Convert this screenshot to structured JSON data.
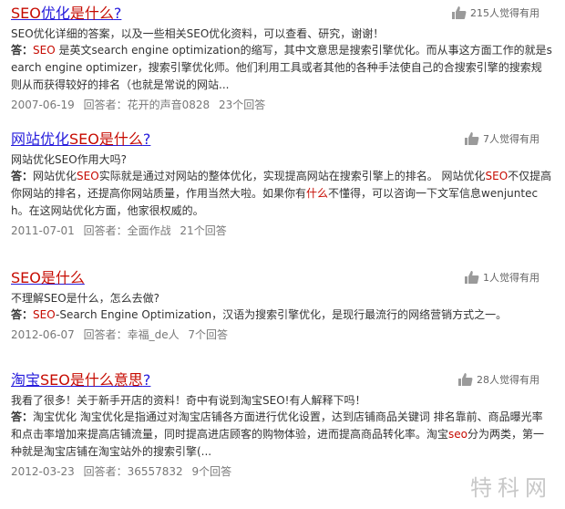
{
  "results": [
    {
      "title_pre": "",
      "title_hl": "SEO",
      "title_mid": "优化",
      "title_hl2": "是什么",
      "title_post": "?",
      "votes": "215人觉得有用",
      "question": "SEO优化详细的答案，以及一些相关SEO优化资料，可以查看、研究，谢谢！",
      "answer_label": "答：",
      "answer_parts": [
        {
          "t": "SEO",
          "hl": true
        },
        {
          "t": " 是英文search engine optimization的缩写，其中文意思是搜索引擎优化。而从事这方面工作的就是search engine optimizer，搜索引擎优化师。他们利用工具或者其他的各种手法使自己的合搜索引擎的搜索规则从而获得较好的排名（也就是常说的网站...",
          "hl": false
        }
      ],
      "date": "2007-06-19",
      "answerer": "回答者：花开的声音0828",
      "count": "23个回答"
    },
    {
      "title_pre": "网站优化",
      "title_hl": "SEO",
      "title_mid": "",
      "title_hl2": "是什么",
      "title_post": "?",
      "votes": "7人觉得有用",
      "question": "网站优化SEO作用大吗?",
      "answer_label": "答：",
      "answer_parts": [
        {
          "t": "网站优化",
          "hl": false
        },
        {
          "t": "SEO",
          "hl": true
        },
        {
          "t": "实际就是通过对网站的整体优化，实现提高网站在搜索引擎上的排名。 网站优化",
          "hl": false
        },
        {
          "t": "SEO",
          "hl": true
        },
        {
          "t": "不仅提高你网站的排名，还提高你网站质量，作用当然大啦。如果你有",
          "hl": false
        },
        {
          "t": "什么",
          "hl": true
        },
        {
          "t": "不懂得，可以咨询一下文军信息wenjuntech。在这网站优化方面，他家很权威的。",
          "hl": false
        }
      ],
      "date": "2011-07-01",
      "answerer": "回答者：全面作战",
      "count": "21个回答"
    },
    {
      "title_pre": "",
      "title_hl": "SEO是什么",
      "title_mid": "",
      "title_hl2": "",
      "title_post": "",
      "votes": "1人觉得有用",
      "question": "不理解SEO是什么，怎么去做?",
      "answer_label": "答：",
      "answer_parts": [
        {
          "t": "SEO",
          "hl": true
        },
        {
          "t": "-Search Engine Optimization，汉语为搜索引擎优化，是现行最流行的网络营销方式之一。",
          "hl": false
        }
      ],
      "date": "2012-06-07",
      "answerer": "回答者：幸福_de人",
      "count": "7个回答"
    },
    {
      "title_pre": "淘宝",
      "title_hl": "SEO是什么",
      "title_mid": "",
      "title_hl2": "意思",
      "title_post": "?",
      "votes": "28人觉得有用",
      "question": "我看了很多！关于新手开店的资料！奇中有说到淘宝SEO!有人解释下吗！",
      "answer_label": "答：",
      "answer_parts": [
        {
          "t": "淘宝优化 淘宝优化是指通过对淘宝店铺各方面进行优化设置，达到店铺商品关键词 排名靠前、商品曝光率和点击率增加来提高店铺流量，同时提高进店顾客的购物体验，进而提高商品转化率。淘宝",
          "hl": false
        },
        {
          "t": "seo",
          "hl": true
        },
        {
          "t": "分为两类，第一种就是淘宝店铺在淘宝站外的搜索引擎(...",
          "hl": false
        }
      ],
      "date": "2012-03-23",
      "answerer": "回答者：36557832",
      "count": "9个回答"
    }
  ],
  "watermark": "特科网",
  "colors": {
    "link": "#261cdc",
    "highlight": "#c60a00",
    "meta": "#777777"
  }
}
